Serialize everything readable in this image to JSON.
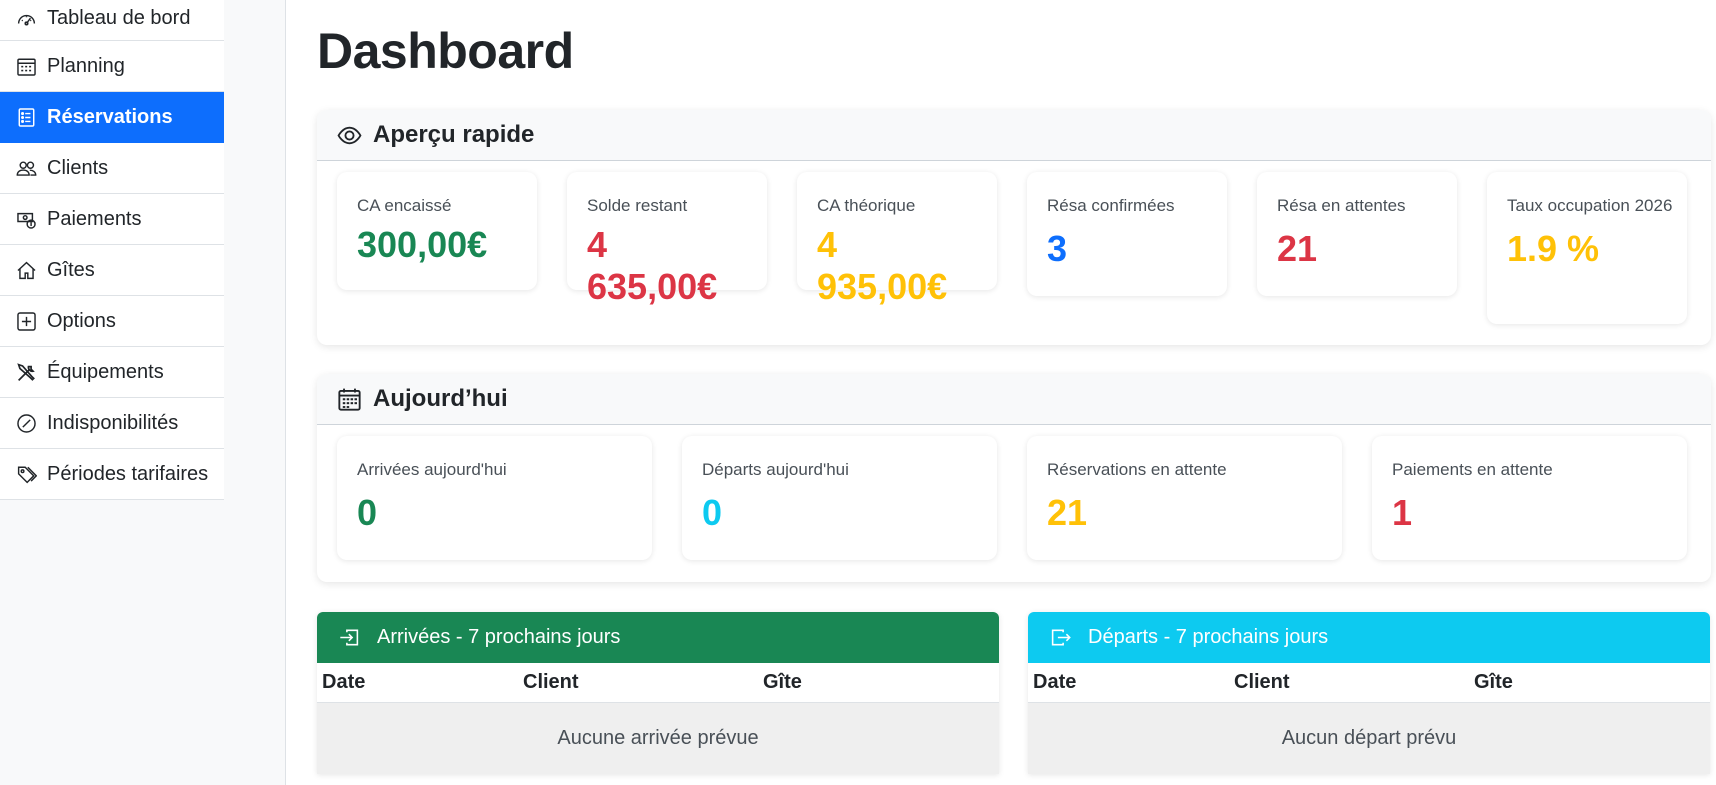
{
  "sidebar": {
    "items": [
      {
        "label": "Tableau de bord",
        "icon": "speedometer-icon"
      },
      {
        "label": "Planning",
        "icon": "calendar-grid-icon"
      },
      {
        "label": "Réservations",
        "icon": "journal-list-icon",
        "active": true
      },
      {
        "label": "Clients",
        "icon": "people-icon"
      },
      {
        "label": "Paiements",
        "icon": "cash-coin-icon"
      },
      {
        "label": "Gîtes",
        "icon": "house-icon"
      },
      {
        "label": "Options",
        "icon": "plus-square-icon"
      },
      {
        "label": "Équipements",
        "icon": "tools-icon"
      },
      {
        "label": "Indisponibilités",
        "icon": "slash-circle-icon"
      },
      {
        "label": "Périodes tarifaires",
        "icon": "tags-icon"
      }
    ]
  },
  "main": {
    "title": "Dashboard",
    "overview": {
      "title": "Aperçu rapide",
      "icon": "eye-icon",
      "stats": [
        {
          "label": "CA encaissé",
          "value": "300,00€",
          "color": "#198754"
        },
        {
          "label": "Solde restant",
          "value": "4 635,00€",
          "color": "#dc3545"
        },
        {
          "label": "CA théorique",
          "value": "4 935,00€",
          "color": "#ffc107"
        },
        {
          "label": "Résa confirmées",
          "value": "3",
          "color": "#0d6efd"
        },
        {
          "label": "Résa en attentes",
          "value": "21",
          "color": "#dc3545"
        },
        {
          "label": "Taux occupation 2026",
          "value": "1.9 %",
          "color": "#ffc107"
        }
      ]
    },
    "today": {
      "title": "Aujourd’hui",
      "icon": "calendar-icon",
      "stats": [
        {
          "label": "Arrivées aujourd'hui",
          "value": "0",
          "color": "#198754"
        },
        {
          "label": "Départs aujourd'hui",
          "value": "0",
          "color": "#0dcaf0"
        },
        {
          "label": "Réservations en attente",
          "value": "21",
          "color": "#ffc107"
        },
        {
          "label": "Paiements en attente",
          "value": "1",
          "color": "#dc3545"
        }
      ]
    },
    "arrivals": {
      "title": "Arrivées - 7 prochains jours",
      "icon": "box-arrow-in-icon",
      "color": "#198754",
      "columns": [
        "Date",
        "Client",
        "Gîte"
      ],
      "empty": "Aucune arrivée prévue"
    },
    "departures": {
      "title": "Départs - 7 prochains jours",
      "icon": "box-arrow-out-icon",
      "color": "#0dcaf0",
      "columns": [
        "Date",
        "Client",
        "Gîte"
      ],
      "empty": "Aucun départ prévu"
    }
  }
}
